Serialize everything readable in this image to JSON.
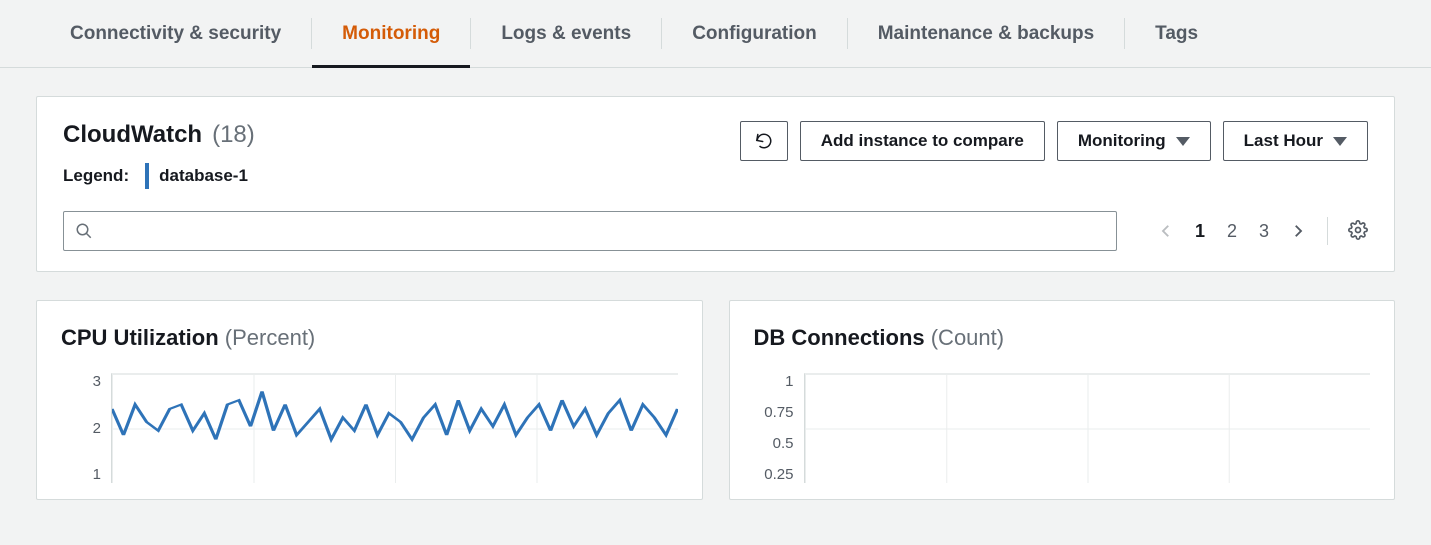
{
  "tabs": [
    {
      "label": "Connectivity & security",
      "active": false
    },
    {
      "label": "Monitoring",
      "active": true
    },
    {
      "label": "Logs & events",
      "active": false
    },
    {
      "label": "Configuration",
      "active": false
    },
    {
      "label": "Maintenance & backups",
      "active": false
    },
    {
      "label": "Tags",
      "active": false
    }
  ],
  "panel": {
    "title": "CloudWatch",
    "count": "(18)",
    "legend_label": "Legend:",
    "legend_item": "database-1",
    "actions": {
      "refresh_tooltip": "Refresh",
      "add_compare": "Add instance to compare",
      "monitoring_label": "Monitoring",
      "range_label": "Last Hour"
    },
    "search": {
      "placeholder": ""
    },
    "pager": {
      "pages": [
        "1",
        "2",
        "3"
      ],
      "current": "1"
    }
  },
  "chart_data": [
    {
      "type": "line",
      "title": "CPU Utilization",
      "unit": "(Percent)",
      "ylabel": "",
      "yticks": [
        1,
        2,
        3
      ],
      "ylim": [
        0.5,
        3
      ],
      "x": [
        0,
        1,
        2,
        3,
        4,
        5,
        6,
        7,
        8,
        9,
        10,
        11,
        12,
        13,
        14,
        15,
        16,
        17,
        18,
        19,
        20,
        21,
        22,
        23,
        24,
        25,
        26,
        27,
        28,
        29,
        30,
        31,
        32,
        33,
        34,
        35,
        36,
        37,
        38,
        39,
        40,
        41,
        42,
        43,
        44,
        45,
        46,
        47,
        48,
        49
      ],
      "series": [
        {
          "name": "database-1",
          "color": "#2e73b8",
          "values": [
            2.2,
            1.6,
            2.3,
            1.9,
            1.7,
            2.2,
            2.3,
            1.7,
            2.1,
            1.5,
            2.3,
            2.4,
            1.8,
            2.6,
            1.7,
            2.3,
            1.6,
            1.9,
            2.2,
            1.5,
            2.0,
            1.7,
            2.3,
            1.6,
            2.1,
            1.9,
            1.5,
            2.0,
            2.3,
            1.6,
            2.4,
            1.7,
            2.2,
            1.8,
            2.3,
            1.6,
            2.0,
            2.3,
            1.7,
            2.4,
            1.8,
            2.2,
            1.6,
            2.1,
            2.4,
            1.7,
            2.3,
            2.0,
            1.6,
            2.2
          ]
        }
      ]
    },
    {
      "type": "line",
      "title": "DB Connections",
      "unit": "(Count)",
      "ylabel": "",
      "yticks": [
        0.25,
        0.5,
        0.75,
        1
      ],
      "ylim": [
        0,
        1
      ],
      "x": [],
      "series": [
        {
          "name": "database-1",
          "color": "#2e73b8",
          "values": []
        }
      ]
    }
  ]
}
